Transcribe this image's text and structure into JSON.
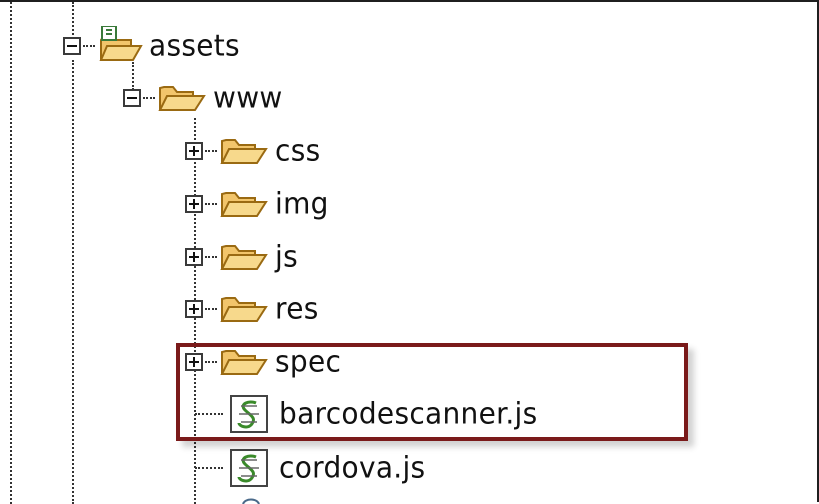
{
  "tree": {
    "items": [
      {
        "label": "assets",
        "state": "expanded",
        "icon": "project-folder-icon"
      },
      {
        "label": "www",
        "state": "expanded",
        "icon": "folder-icon"
      },
      {
        "label": "css",
        "state": "collapsed",
        "icon": "folder-icon"
      },
      {
        "label": "img",
        "state": "collapsed",
        "icon": "folder-icon"
      },
      {
        "label": "js",
        "state": "collapsed",
        "icon": "folder-icon"
      },
      {
        "label": "res",
        "state": "collapsed",
        "icon": "folder-icon"
      },
      {
        "label": "spec",
        "state": "collapsed",
        "icon": "folder-icon"
      },
      {
        "label": "barcodescanner.js",
        "state": "leaf",
        "icon": "javascript-file-icon"
      },
      {
        "label": "cordova.js",
        "state": "leaf",
        "icon": "javascript-file-icon"
      }
    ]
  },
  "highlight": {
    "color": "#7a1a1a",
    "items": [
      "spec",
      "barcodescanner.js"
    ]
  },
  "colors": {
    "folder": "#f2c56b",
    "folder_stroke": "#9a6a12",
    "js_icon": "#3a8a2a"
  }
}
